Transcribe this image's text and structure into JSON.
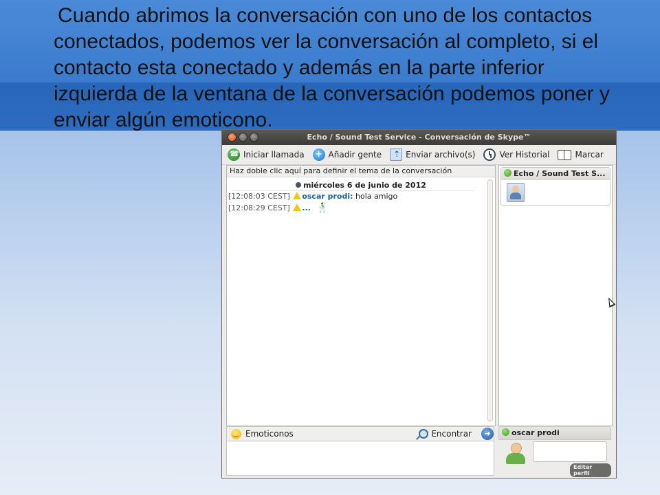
{
  "slide": {
    "text": "Cuando abrimos la conversación con uno de los contactos conectados, podemos ver la conversación al completo, si el contacto esta conectado y además en la parte inferior izquierda de la ventana de la conversación podemos poner y enviar algún emoticono."
  },
  "window": {
    "title": "Echo / Sound Test Service - Conversación de Skype™"
  },
  "toolbar": {
    "call": "Iniciar llamada",
    "add_people": "Añadir gente",
    "send_file": "Enviar archivo(s)",
    "history": "Ver Historial",
    "bookmark": "Marcar"
  },
  "chat": {
    "topic": "Haz doble clic aquí para definir el tema de la conversación",
    "date": "miércoles 6 de junio de 2012",
    "messages": [
      {
        "time": "[12:08:03 CEST]",
        "author": "oscar prodi:",
        "text": "hola amigo"
      },
      {
        "time": "[12:08:29 CEST]",
        "author": "...",
        "text": ""
      }
    ]
  },
  "input": {
    "emoticons": "Emoticonos",
    "find": "Encontrar"
  },
  "contact": {
    "name": "Echo / Sound Test S..."
  },
  "me": {
    "name": "oscar prodi",
    "edit_profile": "Editar perfil"
  }
}
